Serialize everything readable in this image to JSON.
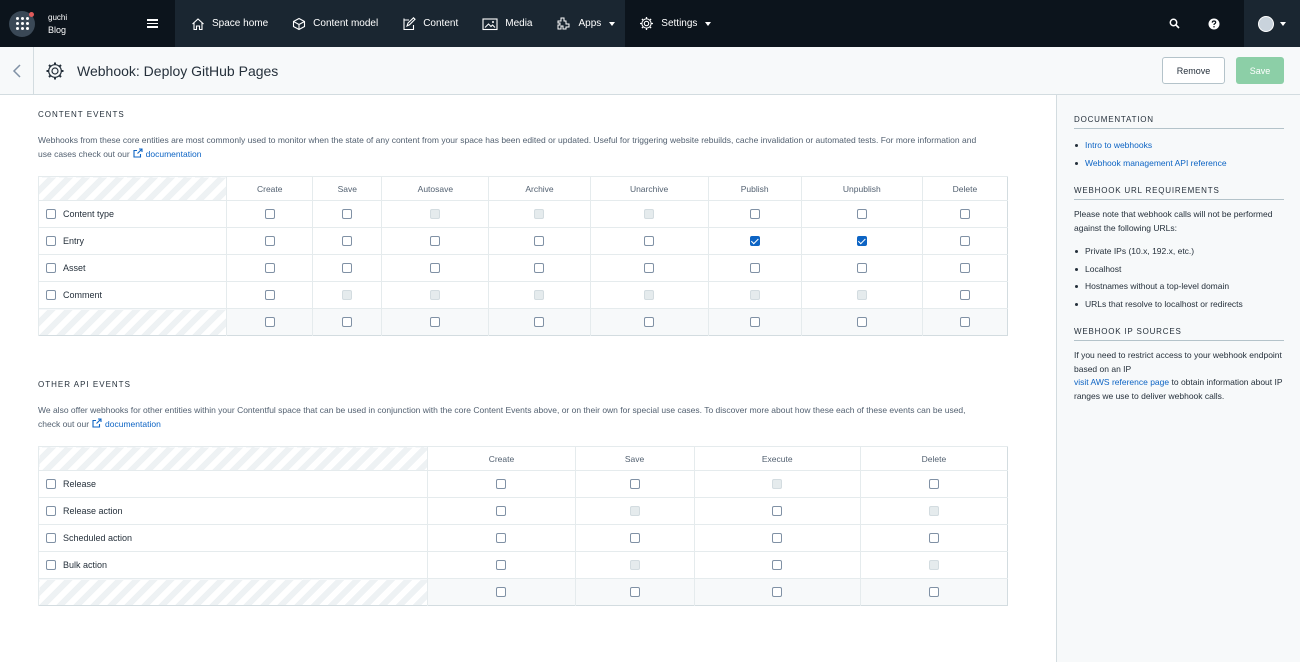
{
  "nav": {
    "org": "guchi",
    "space": "Blog",
    "items": [
      {
        "label": "Space home",
        "icon": "home-icon"
      },
      {
        "label": "Content model",
        "icon": "content-model-icon"
      },
      {
        "label": "Content",
        "icon": "content-icon"
      },
      {
        "label": "Media",
        "icon": "media-icon"
      },
      {
        "label": "Apps",
        "icon": "apps-icon"
      },
      {
        "label": "Settings",
        "icon": "gear-icon"
      }
    ]
  },
  "header": {
    "title": "Webhook: Deploy GitHub Pages",
    "remove_label": "Remove",
    "save_label": "Save"
  },
  "content_events": {
    "title": "CONTENT EVENTS",
    "description": "Webhooks from these core entities are most commonly used to monitor when the state of any content from your space has been edited or updated. Useful for triggering website rebuilds, cache invalidation or automated tests. For more information and use cases check out our",
    "link": "documentation",
    "columns": [
      "Create",
      "Save",
      "Autosave",
      "Archive",
      "Unarchive",
      "Publish",
      "Unpublish",
      "Delete"
    ],
    "rows": [
      {
        "label": "Content type",
        "cells": [
          "off",
          "off",
          "disabled",
          "disabled",
          "disabled",
          "off",
          "off",
          "off"
        ]
      },
      {
        "label": "Entry",
        "cells": [
          "off",
          "off",
          "off",
          "off",
          "off",
          "checked",
          "checked",
          "off"
        ]
      },
      {
        "label": "Asset",
        "cells": [
          "off",
          "off",
          "off",
          "off",
          "off",
          "off",
          "off",
          "off"
        ]
      },
      {
        "label": "Comment",
        "cells": [
          "off",
          "disabled",
          "disabled",
          "disabled",
          "disabled",
          "disabled",
          "disabled",
          "off"
        ]
      }
    ]
  },
  "other_events": {
    "title": "OTHER API EVENTS",
    "description": "We also offer webhooks for other entities within your Contentful space that can be used in conjunction with the core Content Events above, or on their own for special use cases. To discover more about how these each of these events can be used, check out our",
    "link": "documentation",
    "columns": [
      "Create",
      "Save",
      "Execute",
      "Delete"
    ],
    "rows": [
      {
        "label": "Release",
        "cells": [
          "off",
          "off",
          "disabled",
          "off"
        ]
      },
      {
        "label": "Release action",
        "cells": [
          "off",
          "disabled",
          "off",
          "disabled"
        ]
      },
      {
        "label": "Scheduled action",
        "cells": [
          "off",
          "off",
          "off",
          "off"
        ]
      },
      {
        "label": "Bulk action",
        "cells": [
          "off",
          "disabled",
          "off",
          "disabled"
        ]
      }
    ]
  },
  "sidebar": {
    "documentation_heading": "DOCUMENTATION",
    "doc_links": [
      "Intro to webhooks",
      "Webhook management API reference"
    ],
    "url_heading": "WEBHOOK URL REQUIREMENTS",
    "url_text": "Please note that webhook calls will not be performed against the following URLs:",
    "url_list": [
      "Private IPs (10.x, 192.x, etc.)",
      "Localhost",
      "Hostnames without a top-level domain",
      "URLs that resolve to localhost or redirects"
    ],
    "ip_heading": "WEBHOOK IP SOURCES",
    "ip_text_before": "If you need to restrict access to your webhook endpoint based on an IP",
    "ip_link": "visit AWS reference page",
    "ip_text_after": "to obtain information about IP ranges we use to deliver webhook calls."
  }
}
